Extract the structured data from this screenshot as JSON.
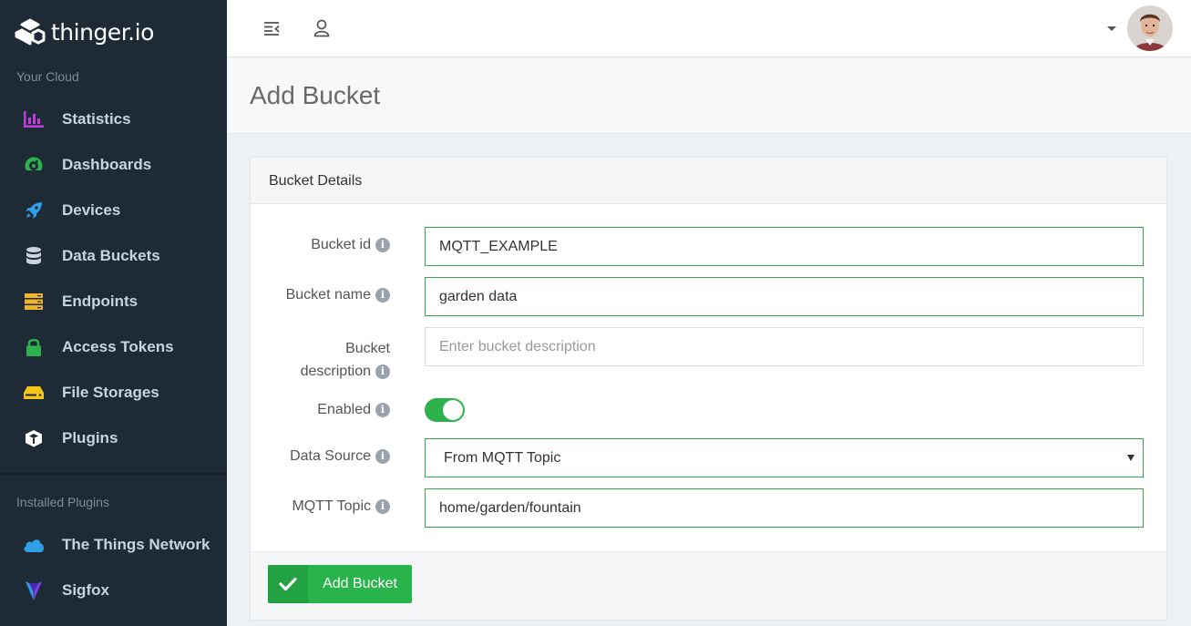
{
  "brand": {
    "name": "thinger.io"
  },
  "sidebar": {
    "section_cloud": "Your Cloud",
    "items": [
      {
        "label": "Statistics",
        "icon": "bar-chart-icon",
        "color": "#c03cdb"
      },
      {
        "label": "Dashboards",
        "icon": "dashboard-gauge-icon",
        "color": "#2bb24c"
      },
      {
        "label": "Devices",
        "icon": "rocket-icon",
        "color": "#2f9fe8"
      },
      {
        "label": "Data Buckets",
        "icon": "database-icon",
        "color": "#c9d3dc"
      },
      {
        "label": "Endpoints",
        "icon": "server-icon",
        "color": "#f0b429"
      },
      {
        "label": "Access Tokens",
        "icon": "lock-icon",
        "color": "#2bb24c"
      },
      {
        "label": "File Storages",
        "icon": "hdd-icon",
        "color": "#f5c518"
      },
      {
        "label": "Plugins",
        "icon": "cube-icon",
        "color": "#ffffff"
      }
    ],
    "section_plugins": "Installed Plugins",
    "plugins": [
      {
        "label": "The Things Network",
        "icon": "cloud-icon",
        "color": "#2f9fe8"
      },
      {
        "label": "Sigfox",
        "icon": "sigfox-logo-icon",
        "color": "#7b3fe4"
      }
    ]
  },
  "topbar": {
    "menu_icon": "collapse-menu-icon",
    "user_icon": "user-icon",
    "avatar_icon": "user-avatar"
  },
  "page": {
    "title": "Add Bucket"
  },
  "panel": {
    "title": "Bucket Details",
    "fields": {
      "bucket_id": {
        "label": "Bucket id",
        "value": "MQTT_EXAMPLE"
      },
      "bucket_name": {
        "label": "Bucket name",
        "value": "garden data"
      },
      "bucket_description": {
        "label_line1": "Bucket",
        "label_line2": "description",
        "value": "",
        "placeholder": "Enter bucket description"
      },
      "enabled": {
        "label": "Enabled",
        "value": true
      },
      "data_source": {
        "label": "Data Source",
        "value": "From MQTT Topic"
      },
      "mqtt_topic": {
        "label": "MQTT Topic",
        "value": "home/garden/fountain"
      }
    },
    "info_glyph": "i",
    "submit_label": "Add Bucket",
    "accent": "#28b44a"
  }
}
